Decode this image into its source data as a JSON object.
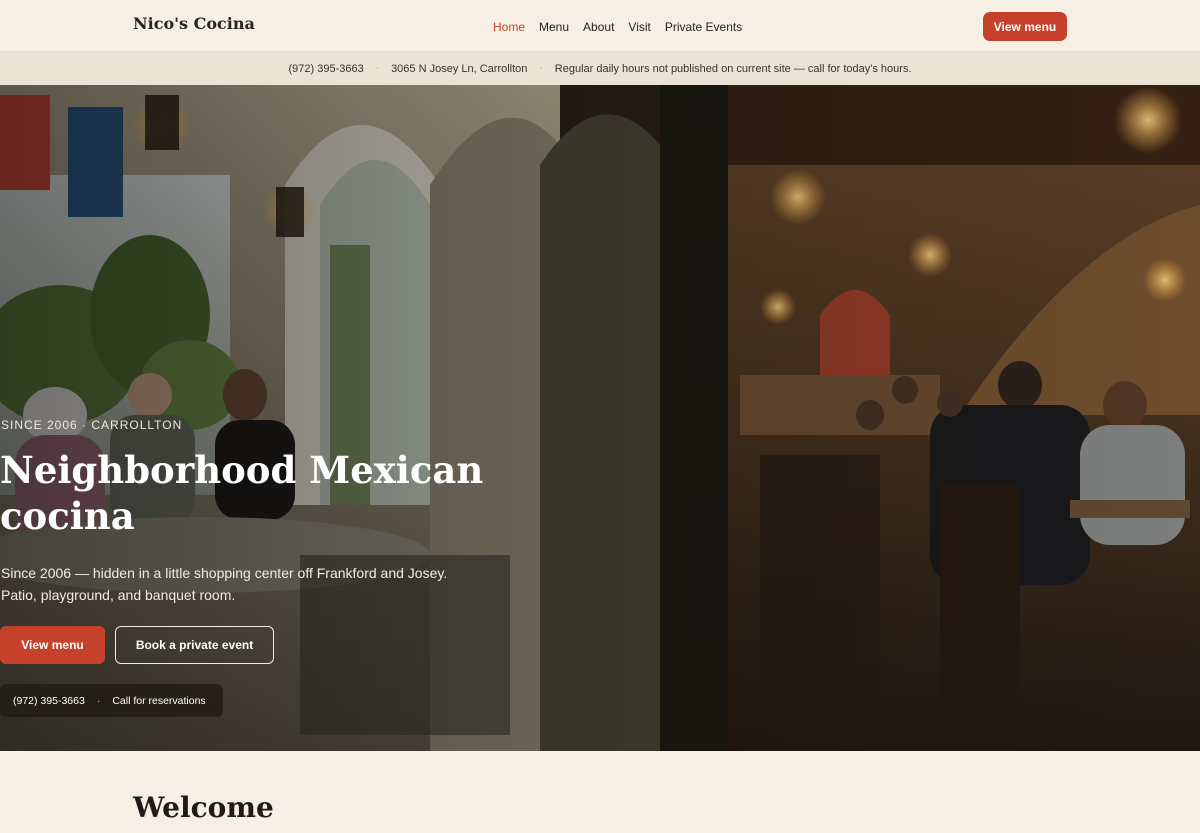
{
  "brand": {
    "name": "Nico's Cocina"
  },
  "nav": {
    "items": [
      "Home",
      "Menu",
      "About",
      "Visit",
      "Private Events"
    ],
    "active": "Home"
  },
  "header": {
    "cta_label": "View menu"
  },
  "info_strip": {
    "phone": "(972) 395-3663",
    "address": "3065 N Josey Ln, Carrollton",
    "hours_note": "Regular daily hours not published on current site — call for today's hours."
  },
  "hero": {
    "eyebrow": "SINCE 2006 · CARROLLTON",
    "title": "Neighborhood Mexican cocina",
    "subtitle_line1": "Since 2006 — hidden in a little shopping center off Frankford and Josey.",
    "subtitle_line2": "Patio, playground, and banquet room.",
    "primary_button": "View menu",
    "secondary_button": "Book a private event",
    "phone": "(972) 395-3663",
    "phone_note": "Call for reservations"
  },
  "welcome": {
    "heading": "Welcome"
  },
  "colors": {
    "accent": "#c5412c",
    "background": "#f5efe4",
    "strip": "#ebe3d4",
    "text": "#2a2420"
  }
}
